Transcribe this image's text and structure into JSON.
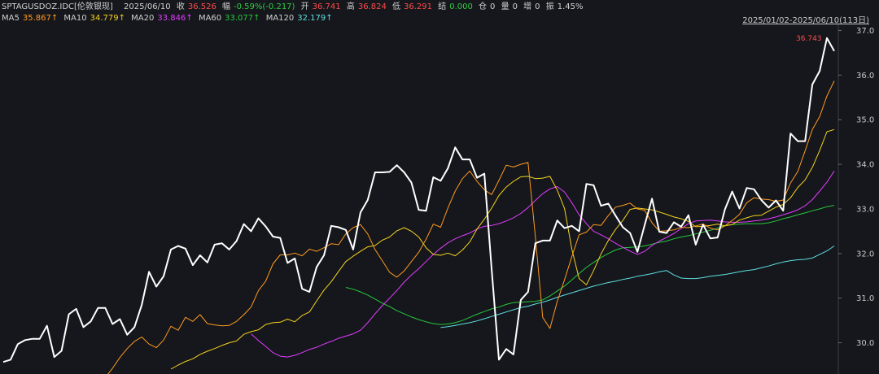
{
  "header": {
    "symbol": "SPTAGUSDOZ.IDC[伦敦银现]",
    "date": "2025/06/10",
    "close_label": "收",
    "close": "36.526",
    "change_label": "幅",
    "change": "-0.59%(-0.217)",
    "open_label": "开",
    "open": "36.741",
    "high_label": "高",
    "high": "36.824",
    "low_label": "低",
    "low": "36.291",
    "settle_label": "结",
    "settle": "0.000",
    "pos_label": "仓",
    "pos": "0",
    "vol_label": "量",
    "vol": "0",
    "inc_label": "增",
    "inc": "0",
    "amp_label": "振",
    "amp": "1.45%"
  },
  "ma_legend": [
    {
      "name": "MA5",
      "value": "35.867↑",
      "color": "#ff9a1f"
    },
    {
      "name": "MA10",
      "value": "34.779↑",
      "color": "#f5d31e"
    },
    {
      "name": "MA20",
      "value": "33.846↑",
      "color": "#e23cff"
    },
    {
      "name": "MA60",
      "value": "33.077↑",
      "color": "#28c83c"
    },
    {
      "name": "MA120",
      "value": "32.179↑",
      "color": "#5fe0e0"
    }
  ],
  "range_label": "2025/01/02-2025/06/10(113日)",
  "chart_data": {
    "type": "line",
    "ylim": [
      29.3,
      37.1
    ],
    "yticks": [
      "30.0",
      "31.0",
      "32.0",
      "33.0",
      "34.0",
      "35.0",
      "36.0",
      "37.0"
    ],
    "last_price_label": "36.743",
    "series": [
      {
        "name": "price",
        "color": "#ffffff",
        "values": [
          29.57,
          29.62,
          29.97,
          30.06,
          30.09,
          30.09,
          30.38,
          29.68,
          29.82,
          30.64,
          30.76,
          30.35,
          30.48,
          30.78,
          30.78,
          30.42,
          30.53,
          30.18,
          30.35,
          30.85,
          31.59,
          31.26,
          31.49,
          32.09,
          32.17,
          32.11,
          31.74,
          31.96,
          31.8,
          32.2,
          32.23,
          32.09,
          32.28,
          32.66,
          32.5,
          32.79,
          32.61,
          32.38,
          32.35,
          31.79,
          31.89,
          31.21,
          31.14,
          31.7,
          31.96,
          32.62,
          32.59,
          32.53,
          32.09,
          32.92,
          33.2,
          33.82,
          33.82,
          33.83,
          33.98,
          33.82,
          33.59,
          32.98,
          32.96,
          33.71,
          33.63,
          33.91,
          34.38,
          34.11,
          34.11,
          33.7,
          33.79,
          31.64,
          29.62,
          29.86,
          29.74,
          30.96,
          31.14,
          32.23,
          32.29,
          32.29,
          32.74,
          32.57,
          32.62,
          32.5,
          33.56,
          33.53,
          33.07,
          33.12,
          32.85,
          32.59,
          32.46,
          32.04,
          32.64,
          33.23,
          32.49,
          32.46,
          32.7,
          32.6,
          32.86,
          32.2,
          32.65,
          32.34,
          32.36,
          32.99,
          33.39,
          33.01,
          33.47,
          33.44,
          33.2,
          33.03,
          33.19,
          32.96,
          34.69,
          34.52,
          34.52,
          35.79,
          36.09,
          36.83,
          36.54
        ]
      },
      {
        "name": "MA5",
        "color": "#ff9a1f",
        "values": [
          29.26,
          29.22,
          29.43,
          29.67,
          29.87,
          30.03,
          30.13,
          29.97,
          29.89,
          30.06,
          30.37,
          30.28,
          30.57,
          30.48,
          30.63,
          30.43,
          30.4,
          30.38,
          30.39,
          30.48,
          30.63,
          30.8,
          31.17,
          31.38,
          31.77,
          31.97,
          31.97,
          32.01,
          31.95,
          32.1,
          32.05,
          32.13,
          32.22,
          32.2,
          32.44,
          32.58,
          32.65,
          32.44,
          32.09,
          31.84,
          31.58,
          31.47,
          31.61,
          31.82,
          32.03,
          32.32,
          32.66,
          32.59,
          33.02,
          33.4,
          33.68,
          33.85,
          33.62,
          33.43,
          33.32,
          33.64,
          33.98,
          33.94,
          34.0,
          34.04,
          32.38,
          30.57,
          30.32,
          30.93,
          31.41,
          31.93,
          32.42,
          32.48,
          32.65,
          32.63,
          32.85,
          33.04,
          33.08,
          33.13,
          33.0,
          32.97,
          32.69,
          32.5,
          32.51,
          32.53,
          32.59,
          32.58,
          32.62,
          32.66,
          32.57,
          32.53,
          32.62,
          32.74,
          32.88,
          33.14,
          33.25,
          33.22,
          33.21,
          33.17,
          33.2,
          33.58,
          33.84,
          34.3,
          34.78,
          35.07,
          35.53,
          35.87
        ]
      },
      {
        "name": "MA10",
        "color": "#f5d31e",
        "values": [
          29.41,
          29.5,
          29.58,
          29.64,
          29.74,
          29.81,
          29.87,
          29.94,
          30.0,
          30.04,
          30.19,
          30.25,
          30.29,
          30.41,
          30.45,
          30.46,
          30.53,
          30.47,
          30.61,
          30.69,
          30.94,
          31.18,
          31.37,
          31.6,
          31.82,
          31.94,
          32.05,
          32.15,
          32.18,
          32.3,
          32.37,
          32.51,
          32.58,
          32.5,
          32.37,
          32.13,
          31.98,
          31.96,
          32.01,
          31.95,
          32.08,
          32.26,
          32.55,
          32.77,
          33.02,
          33.3,
          33.49,
          33.62,
          33.72,
          33.73,
          33.68,
          33.69,
          33.73,
          33.42,
          33.01,
          32.1,
          31.44,
          31.3,
          31.62,
          31.99,
          32.29,
          32.54,
          32.74,
          32.99,
          33.02,
          33.0,
          32.98,
          32.93,
          32.88,
          32.82,
          32.78,
          32.72,
          32.6,
          32.61,
          32.63,
          32.66,
          32.62,
          32.65,
          32.75,
          32.8,
          32.85,
          32.86,
          32.95,
          33.04,
          33.1,
          33.25,
          33.48,
          33.65,
          33.93,
          34.31,
          34.73,
          34.78
        ]
      },
      {
        "name": "MA20",
        "color": "#e23cff",
        "values": [
          30.2,
          30.05,
          29.92,
          29.78,
          29.7,
          29.68,
          29.72,
          29.78,
          29.85,
          29.9,
          29.97,
          30.03,
          30.1,
          30.15,
          30.2,
          30.28,
          30.45,
          30.65,
          30.83,
          31.0,
          31.17,
          31.36,
          31.52,
          31.66,
          31.82,
          31.98,
          32.12,
          32.24,
          32.33,
          32.4,
          32.46,
          32.55,
          32.61,
          32.63,
          32.67,
          32.73,
          32.8,
          32.9,
          33.03,
          33.19,
          33.34,
          33.45,
          33.5,
          33.38,
          33.14,
          32.87,
          32.67,
          32.5,
          32.42,
          32.33,
          32.23,
          32.14,
          32.05,
          31.98,
          32.05,
          32.18,
          32.28,
          32.36,
          32.45,
          32.56,
          32.67,
          32.73,
          32.74,
          32.75,
          32.73,
          32.71,
          32.7,
          32.7,
          32.71,
          32.73,
          32.75,
          32.78,
          32.82,
          32.87,
          32.92,
          32.98,
          33.07,
          33.21,
          33.4,
          33.6,
          33.85
        ]
      },
      {
        "name": "MA60",
        "color": "#28c83c",
        "values": [
          31.24,
          31.2,
          31.14,
          31.07,
          30.98,
          30.89,
          30.81,
          30.72,
          30.65,
          30.58,
          30.52,
          30.47,
          30.43,
          30.41,
          30.42,
          30.45,
          30.5,
          30.57,
          30.64,
          30.7,
          30.76,
          30.8,
          30.86,
          30.9,
          30.91,
          30.92,
          30.93,
          30.96,
          31.05,
          31.16,
          31.27,
          31.41,
          31.55,
          31.69,
          31.8,
          31.91,
          32.0,
          32.08,
          32.13,
          32.14,
          32.15,
          32.17,
          32.21,
          32.25,
          32.28,
          32.33,
          32.37,
          32.4,
          32.44,
          32.48,
          32.52,
          32.57,
          32.63,
          32.65,
          32.66,
          32.67,
          32.67,
          32.67,
          32.69,
          32.73,
          32.78,
          32.82,
          32.87,
          32.91,
          32.96,
          33.0,
          33.05,
          33.08
        ]
      },
      {
        "name": "MA120",
        "color": "#5fe0e0",
        "values": [
          30.34,
          30.36,
          30.39,
          30.42,
          30.45,
          30.49,
          30.54,
          30.59,
          30.64,
          30.69,
          30.74,
          30.79,
          30.82,
          30.87,
          30.91,
          30.96,
          31.02,
          31.07,
          31.12,
          31.17,
          31.22,
          31.27,
          31.31,
          31.35,
          31.38,
          31.42,
          31.45,
          31.49,
          31.52,
          31.55,
          31.59,
          31.62,
          31.52,
          31.45,
          31.44,
          31.44,
          31.46,
          31.49,
          31.51,
          31.53,
          31.56,
          31.59,
          31.62,
          31.64,
          31.68,
          31.72,
          31.77,
          31.81,
          31.84,
          31.86,
          31.87,
          31.9,
          31.98,
          32.06,
          32.17
        ]
      }
    ]
  }
}
